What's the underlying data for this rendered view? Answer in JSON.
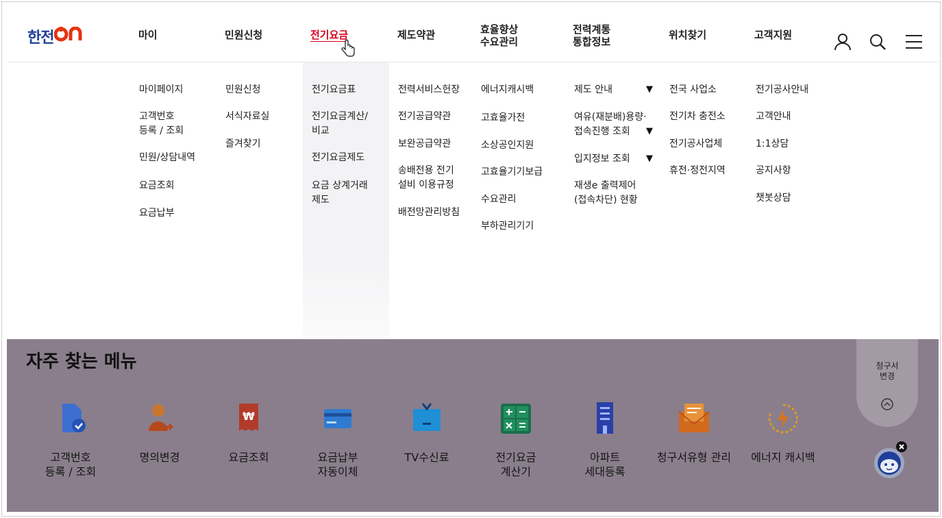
{
  "logo": {
    "brand": "한전",
    "suffix": "ON"
  },
  "nav": [
    {
      "label": "마이"
    },
    {
      "label": "민원신청"
    },
    {
      "label": "전기요금"
    },
    {
      "label": "제도약관"
    },
    {
      "label": "효율향상\n수요관리"
    },
    {
      "label": "전력계통\n통합정보"
    },
    {
      "label": "위치찾기"
    },
    {
      "label": "고객지원"
    }
  ],
  "header_icons": [
    "user-icon",
    "search-icon",
    "menu-icon"
  ],
  "dropdown": {
    "col1": [
      "마이페이지",
      "고객번호\n등록 / 조회",
      "민원/상담내역",
      "요금조회",
      "요금납부"
    ],
    "col2": [
      "민원신청",
      "서식자료실",
      "즐겨찾기"
    ],
    "col3": [
      "전기요금표",
      "전기요금계산/\n비교",
      "전기요금제도",
      "요금 상계거래\n제도"
    ],
    "col4": [
      "전력서비스헌장",
      "전기공급약관",
      "보완공급약관",
      "송배전용 전기\n설비 이용규정",
      "배전망관리방침"
    ],
    "col5": [
      "에너지캐시백",
      "고효율가전",
      "소상공인지원",
      "고효율기기보급",
      "수요관리",
      "부하관리기기"
    ],
    "col6": [
      "제도 안내",
      "여유(재분배)용량·\n접속진행 조회",
      "입지정보 조회",
      "재생e 출력제어\n(접속차단) 현황"
    ],
    "col7": [
      "전국 사업소",
      "전기차 충전소",
      "전기공사업체",
      "휴전·정전지역"
    ],
    "col8": [
      "전기공사안내",
      "고객안내",
      "1:1상담",
      "공지사항",
      "챗봇상담"
    ]
  },
  "quick_menu": {
    "title": "자주 찾는 메뉴",
    "items": [
      {
        "label": "고객번호\n등록 / 조회",
        "icon": "document-check-icon"
      },
      {
        "label": "명의변경",
        "icon": "person-change-icon"
      },
      {
        "label": "요금조회",
        "icon": "receipt-won-icon"
      },
      {
        "label": "요금납부\n자동이체",
        "icon": "card-icon"
      },
      {
        "label": "TV수신료",
        "icon": "tv-icon"
      },
      {
        "label": "전기요금\n계산기",
        "icon": "calculator-icon"
      },
      {
        "label": "아파트\n세대등록",
        "icon": "apartment-icon"
      },
      {
        "label": "청구서유형 관리",
        "icon": "envelope-icon"
      },
      {
        "label": "에너지 캐시백",
        "icon": "energy-cashback-icon"
      }
    ]
  },
  "side_widget": {
    "label": "청구서\n변경"
  },
  "colors": {
    "accent": "#d6001c",
    "brand_blue": "#1f3f9a",
    "overlay": "#8a7e8c"
  }
}
